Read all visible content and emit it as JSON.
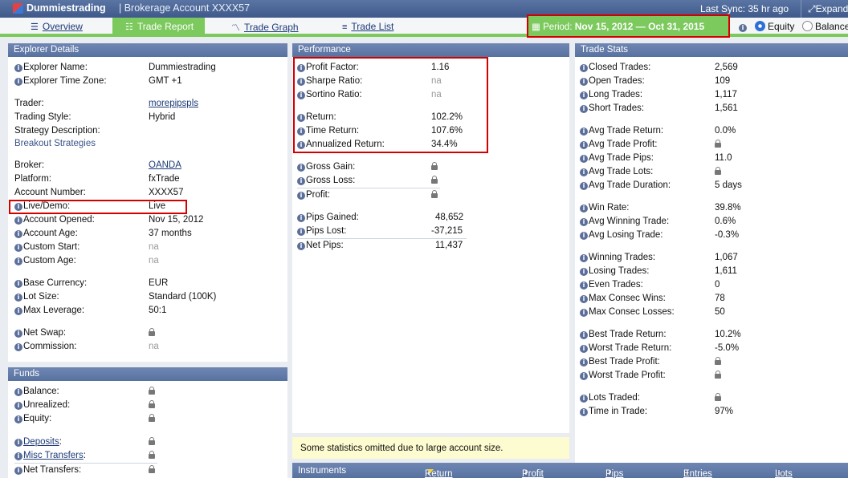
{
  "topbar": {
    "brand": "Dummiestrading",
    "account": "| Brokerage Account XXXX57",
    "sync": "Last Sync: 35 hr ago",
    "expand": "Expand"
  },
  "tabs": {
    "overview": "Overview",
    "trade_report": "Trade Report",
    "trade_graph": "Trade Graph",
    "trade_list": "Trade List"
  },
  "period": {
    "label": "Period:",
    "value": "Nov 15, 2012 — Oct 31, 2015"
  },
  "radios": {
    "equity": "Equity",
    "balance": "Balance",
    "selected": "Equity"
  },
  "explorer": {
    "title": "Explorer Details",
    "name_label": "Explorer Name:",
    "name": "Dummiestrading",
    "tz_label": "Explorer Time Zone:",
    "tz": "GMT +1",
    "trader_label": "Trader:",
    "trader": "morepipspls",
    "style_label": "Trading Style:",
    "style": "Hybrid",
    "strategy_label": "Strategy Description:",
    "strategy": "Breakout Strategies",
    "broker_label": "Broker:",
    "broker": "OANDA",
    "platform_label": "Platform:",
    "platform": "fxTrade",
    "acctnum_label": "Account Number:",
    "acctnum": "XXXX57",
    "live_label": "Live/Demo:",
    "live": "Live",
    "opened_label": "Account Opened:",
    "opened": "Nov 15, 2012",
    "age_label": "Account Age:",
    "age": "37 months",
    "cstart_label": "Custom Start:",
    "cstart": "na",
    "cage_label": "Custom Age:",
    "cage": "na",
    "currency_label": "Base Currency:",
    "currency": "EUR",
    "lot_label": "Lot Size:",
    "lot": "Standard (100K)",
    "leverage_label": "Max Leverage:",
    "leverage": "50:1",
    "swap_label": "Net Swap:",
    "commission_label": "Commission:",
    "commission": "na"
  },
  "funds": {
    "title": "Funds",
    "balance_label": "Balance:",
    "unrealized_label": "Unrealized:",
    "equity_label": "Equity:",
    "deposits_label": "Deposits",
    "misc_label": "Misc Transfers",
    "net_label": "Net Transfers:"
  },
  "performance": {
    "title": "Performance",
    "pf_label": "Profit Factor:",
    "pf": "1.16",
    "sharpe_label": "Sharpe Ratio:",
    "sharpe": "na",
    "sortino_label": "Sortino Ratio:",
    "sortino": "na",
    "return_label": "Return:",
    "return": "102.2%",
    "time_return_label": "Time Return:",
    "time_return": "107.6%",
    "ann_return_label": "Annualized Return:",
    "ann_return": "34.4%",
    "gross_gain_label": "Gross Gain:",
    "gross_loss_label": "Gross Loss:",
    "profit_label": "Profit:",
    "pips_gained_label": "Pips Gained:",
    "pips_gained": "48,652",
    "pips_lost_label": "Pips Lost:",
    "pips_lost": "-37,215",
    "net_pips_label": "Net Pips:",
    "net_pips": "11,437",
    "notice": "Some statistics omitted due to large account size."
  },
  "stats": {
    "title": "Trade Stats",
    "closed_label": "Closed Trades:",
    "closed": "2,569",
    "open_label": "Open Trades:",
    "open": "109",
    "long_label": "Long Trades:",
    "long": "1,117",
    "short_label": "Short Trades:",
    "short": "1,561",
    "avg_return_label": "Avg Trade Return:",
    "avg_return": "0.0%",
    "avg_profit_label": "Avg Trade Profit:",
    "avg_pips_label": "Avg Trade Pips:",
    "avg_pips": "11.0",
    "avg_lots_label": "Avg Trade Lots:",
    "avg_duration_label": "Avg Trade Duration:",
    "avg_duration": "5 days",
    "win_rate_label": "Win Rate:",
    "win_rate": "39.8%",
    "avg_win_label": "Avg Winning Trade:",
    "avg_win": "0.6%",
    "avg_loss_label": "Avg Losing Trade:",
    "avg_loss": "-0.3%",
    "winning_label": "Winning Trades:",
    "winning": "1,067",
    "losing_label": "Losing Trades:",
    "losing": "1,611",
    "even_label": "Even Trades:",
    "even": "0",
    "max_wins_label": "Max Consec Wins:",
    "max_wins": "78",
    "max_losses_label": "Max Consec Losses:",
    "max_losses": "50",
    "best_return_label": "Best Trade Return:",
    "best_return": "10.2%",
    "worst_return_label": "Worst Trade Return:",
    "worst_return": "-5.0%",
    "best_profit_label": "Best Trade Profit:",
    "worst_profit_label": "Worst Trade Profit:",
    "lots_label": "Lots Traded:",
    "time_label": "Time in Trade:",
    "time": "97%"
  },
  "instruments": {
    "title": "Instruments",
    "return": "Return",
    "profit": "Profit",
    "pips": "Pips",
    "entries": "Entries",
    "lots": "Lots"
  },
  "colors": {
    "accent_green": "#7cc95e",
    "highlight_red": "#d40000",
    "header_blue": "#5872a0"
  }
}
